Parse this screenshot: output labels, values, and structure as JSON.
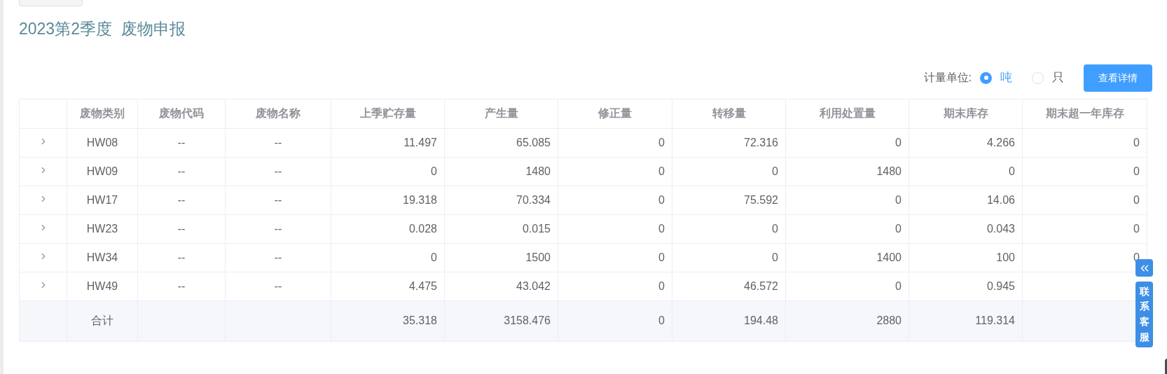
{
  "title": "2023第2季度  废物申报",
  "unit_selector": {
    "label": "计量单位:",
    "options": [
      {
        "label": "吨",
        "selected": true
      },
      {
        "label": "只",
        "selected": false
      }
    ]
  },
  "detail_button": "查看详情",
  "table": {
    "columns": [
      "废物类别",
      "废物代码",
      "废物名称",
      "上季贮存量",
      "产生量",
      "修正量",
      "转移量",
      "利用处置量",
      "期末库存",
      "期末超一年库存"
    ],
    "rows": [
      {
        "expanded": false,
        "cells": [
          "HW08",
          "--",
          "--",
          "11.497",
          "65.085",
          "0",
          "72.316",
          "0",
          "4.266",
          "0"
        ]
      },
      {
        "expanded": false,
        "cells": [
          "HW09",
          "--",
          "--",
          "0",
          "1480",
          "0",
          "0",
          "1480",
          "0",
          "0"
        ]
      },
      {
        "expanded": false,
        "cells": [
          "HW17",
          "--",
          "--",
          "19.318",
          "70.334",
          "0",
          "75.592",
          "0",
          "14.06",
          "0"
        ]
      },
      {
        "expanded": false,
        "cells": [
          "HW23",
          "--",
          "--",
          "0.028",
          "0.015",
          "0",
          "0",
          "0",
          "0.043",
          "0"
        ]
      },
      {
        "expanded": false,
        "cells": [
          "HW34",
          "--",
          "--",
          "0",
          "1500",
          "0",
          "0",
          "1400",
          "100",
          "0"
        ]
      },
      {
        "expanded": false,
        "cells": [
          "HW49",
          "--",
          "--",
          "4.475",
          "43.042",
          "0",
          "46.572",
          "0",
          "0.945",
          ""
        ]
      }
    ],
    "total": {
      "label": "合计",
      "cells": [
        "",
        "",
        "35.318",
        "3158.476",
        "0",
        "194.48",
        "2880",
        "119.314",
        ""
      ]
    }
  },
  "contact_widget": {
    "label": "联系客服"
  }
}
